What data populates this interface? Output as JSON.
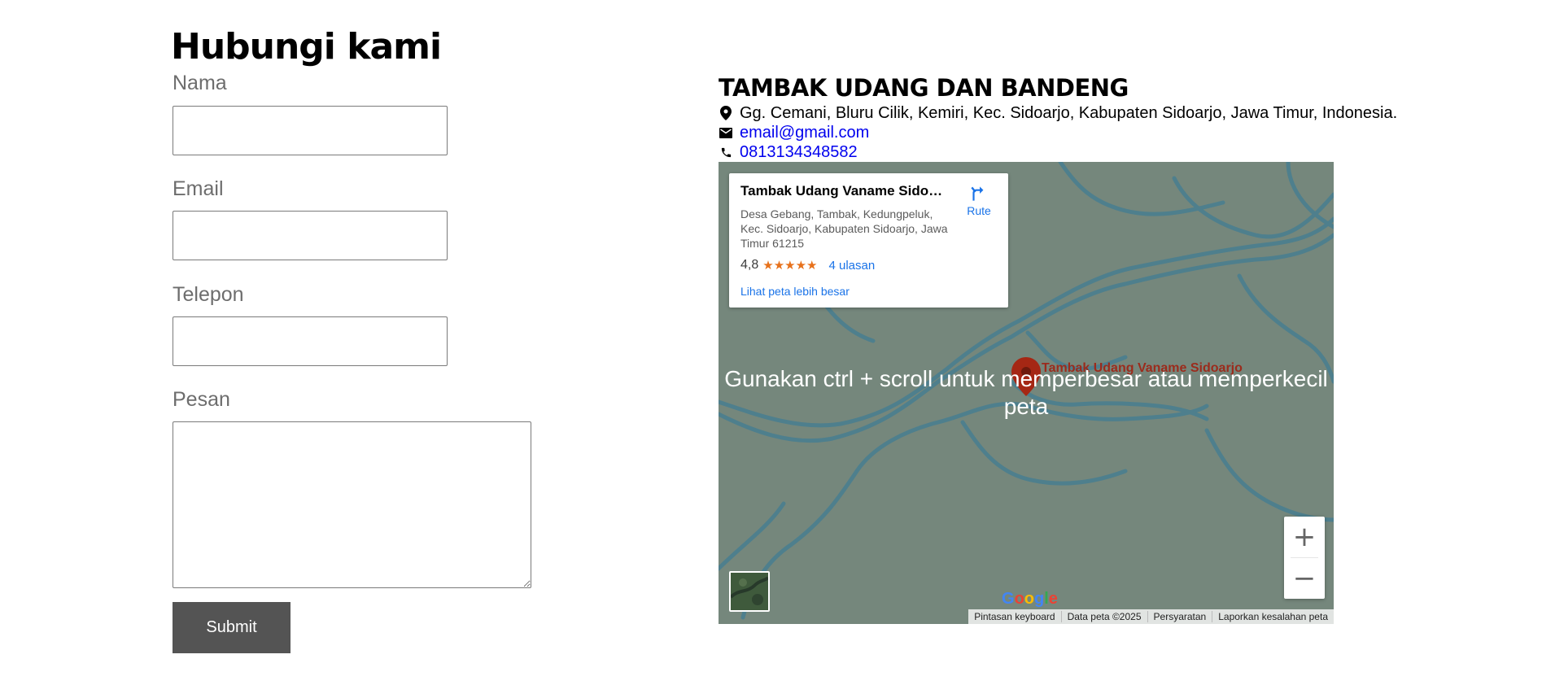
{
  "form": {
    "title": "Hubungi kami",
    "name_label": "Nama",
    "email_label": "Email",
    "phone_label": "Telepon",
    "message_label": "Pesan",
    "name_value": "",
    "email_value": "",
    "phone_value": "",
    "message_value": "",
    "submit_label": "Submit"
  },
  "info": {
    "title": "TAMBAK UDANG DAN BANDENG",
    "address": "Gg. Cemani, Bluru Cilik, Kemiri, Kec. Sidoarjo, Kabupaten Sidoarjo, Jawa Timur, Indonesia.",
    "email": "email@gmail.com",
    "phone": "0813134348582",
    "icons": [
      "location-pin-icon",
      "mail-icon",
      "phone-icon"
    ]
  },
  "map": {
    "place_name": "Tambak Udang Vaname Sidoa...",
    "place_address": "Desa Gebang, Tambak, Kedungpeluk, Kec. Sidoarjo, Kabupaten Sidoarjo, Jawa Timur 61215",
    "route_label": "Rute",
    "rating": "4,8",
    "stars": "★★★★★",
    "reviews_label": "4 ulasan",
    "bigger_map_label": "Lihat peta lebih besar",
    "marker_label": "Tambak Udang Vaname Sidoarjo",
    "overlay_text": "Gunakan ctrl + scroll untuk memperbesar atau memperkecil peta",
    "zoom_in": "+",
    "zoom_out": "−",
    "google_letters": [
      "G",
      "o",
      "o",
      "g",
      "l",
      "e"
    ],
    "attribution": [
      "Pintasan keyboard",
      "Data peta ©2025",
      "Persyaratan",
      "Laporkan kesalahan peta"
    ],
    "colors": {
      "map_bg": "#75877c",
      "river": "#4e7f8d",
      "link": "#1a73e8",
      "star": "#e7711b",
      "marker": "#a52714",
      "google": [
        "#4285f4",
        "#ea4335",
        "#fbbc05",
        "#4285f4",
        "#34a853",
        "#ea4335"
      ]
    }
  }
}
